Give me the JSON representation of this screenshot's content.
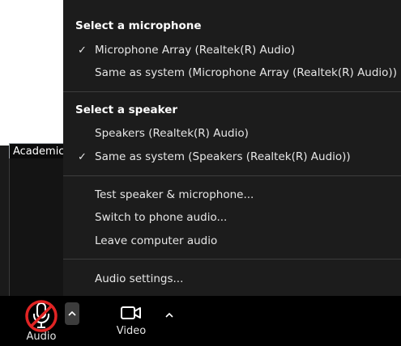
{
  "menu": {
    "microphone": {
      "title": "Select a microphone",
      "items": [
        {
          "label": "Microphone Array (Realtek(R) Audio)",
          "checked": true
        },
        {
          "label": "Same as system (Microphone Array (Realtek(R) Audio))",
          "checked": false
        }
      ]
    },
    "speaker": {
      "title": "Select a speaker",
      "items": [
        {
          "label": "Speakers (Realtek(R) Audio)",
          "checked": false
        },
        {
          "label": "Same as system (Speakers (Realtek(R) Audio))",
          "checked": true
        }
      ]
    },
    "actions": [
      {
        "label": "Test speaker & microphone..."
      },
      {
        "label": "Switch to phone audio..."
      },
      {
        "label": "Leave computer audio"
      }
    ],
    "settings": {
      "label": "Audio settings..."
    },
    "check_glyph": "✓"
  },
  "participant": {
    "name": "Academic"
  },
  "toolbar": {
    "audio_label": "Audio",
    "video_label": "Video",
    "mute_color": "#e02424"
  },
  "icons": {
    "audio": "microphone-muted-icon",
    "video": "video-camera-icon",
    "caret": "chevron-up-icon"
  }
}
